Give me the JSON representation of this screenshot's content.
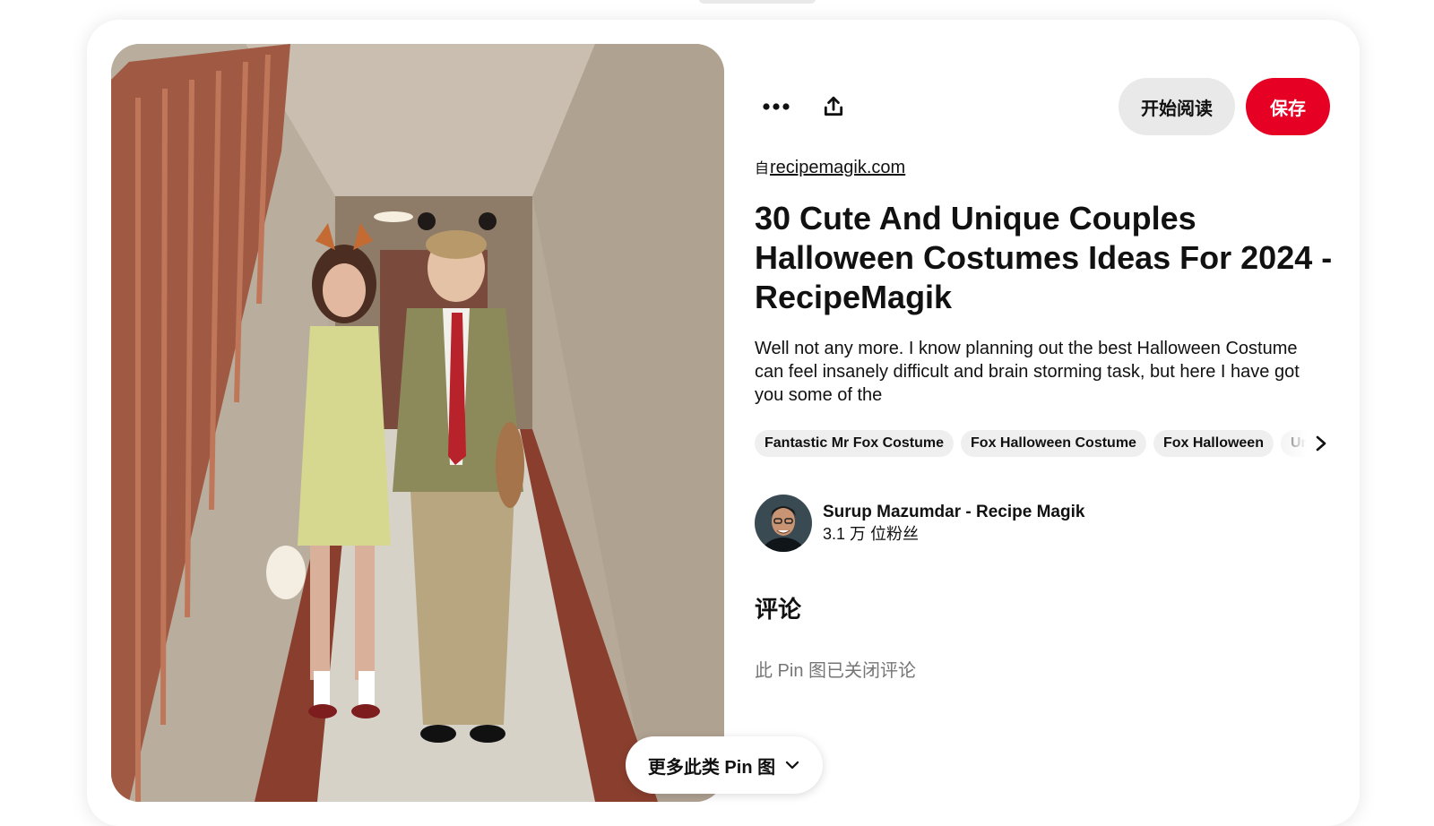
{
  "toolbar": {
    "more_icon": "more-horizontal-icon",
    "share_icon": "share-upload-icon",
    "read_label": "开始阅读",
    "save_label": "保存"
  },
  "source": {
    "prefix": "自",
    "domain": "recipemagik.com"
  },
  "pin": {
    "title": "30 Cute And Unique Couples Halloween Costumes Ideas For 2024 - RecipeMagik",
    "description": "Well not any more. I know planning out the best Halloween Costume can feel insanely difficult and brain storming task, but here I have got you some of the",
    "image_alt": "Couple in fox-eared Halloween costumes standing in a hallway"
  },
  "tags": [
    "Fantastic Mr Fox Costume",
    "Fox Halloween Costume",
    "Fox Halloween",
    "Un"
  ],
  "author": {
    "name": "Surup Mazumdar - Recipe Magik",
    "followers": "3.1 万 位粉丝"
  },
  "comments": {
    "heading": "评论",
    "status": "此 Pin 图已关闭评论"
  },
  "more_like_this": {
    "label": "更多此类 Pin 图"
  },
  "colors": {
    "save_red": "#e60023",
    "pill_gray": "#e9e9e9",
    "muted_text": "#767676"
  }
}
